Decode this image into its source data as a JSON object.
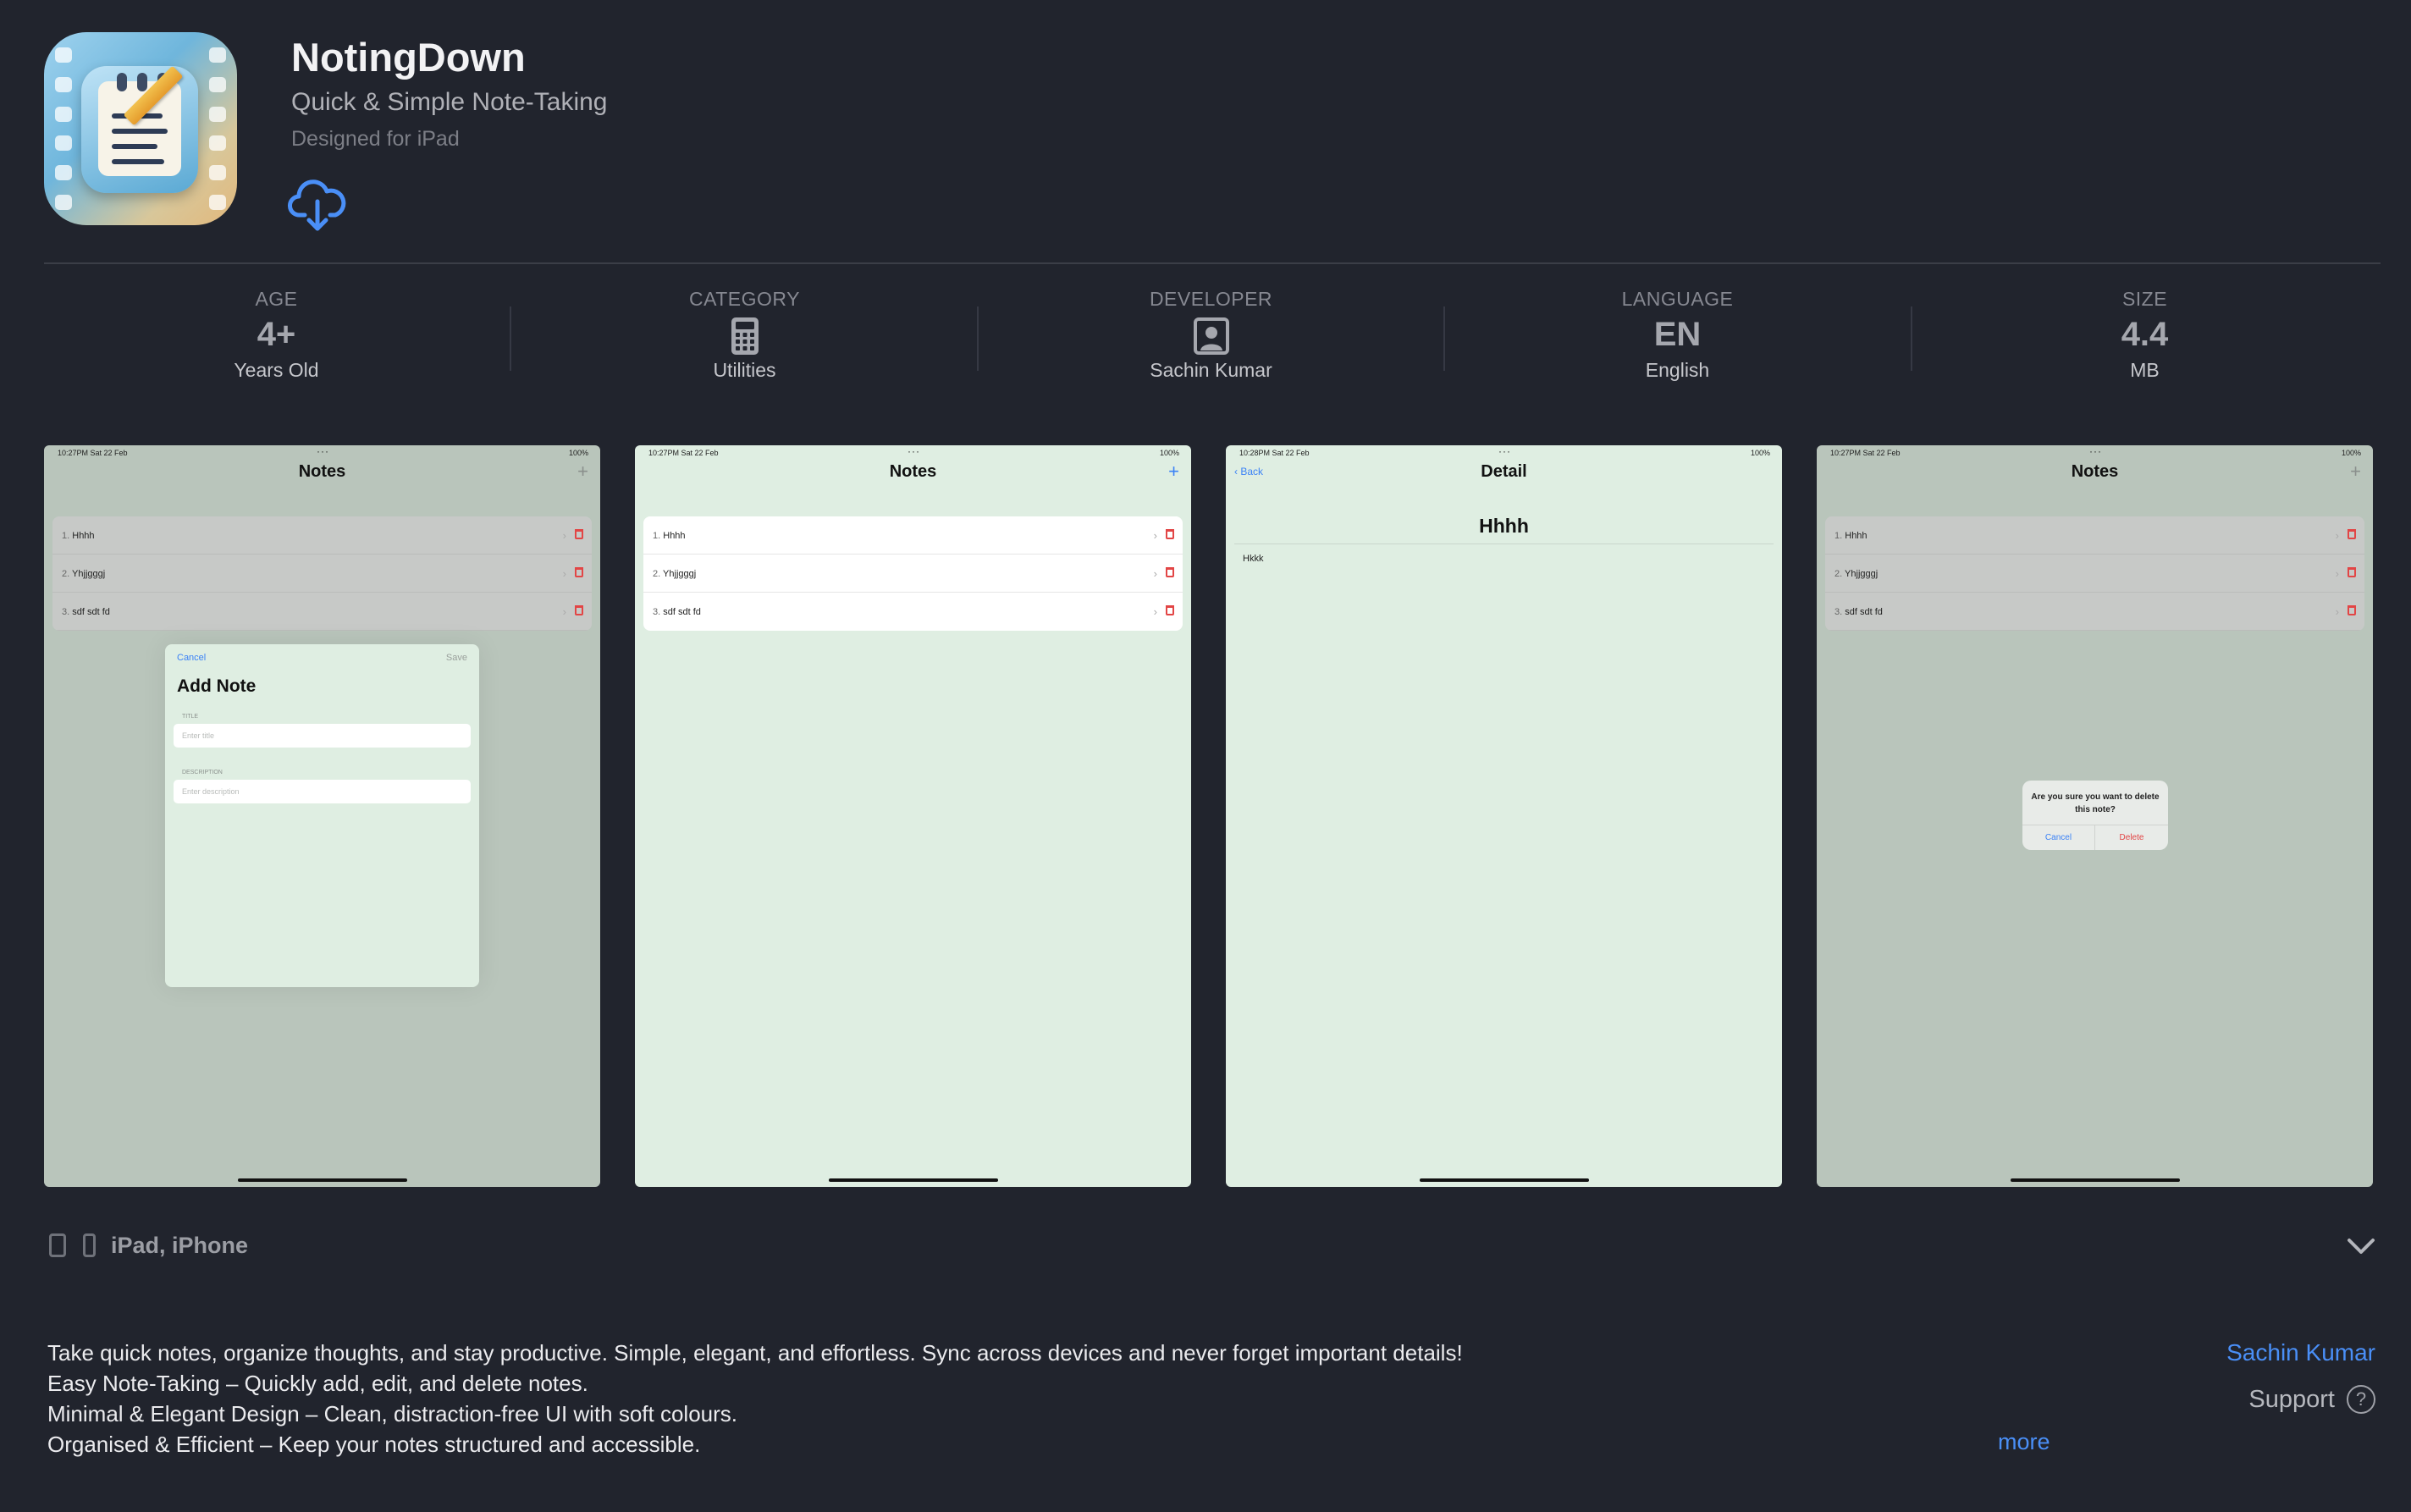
{
  "app": {
    "title": "NotingDown",
    "subtitle": "Quick & Simple Note-Taking",
    "designed_for": "Designed for iPad",
    "get_icon": "cloud-download-icon",
    "accent": "#4a8ff7"
  },
  "info": [
    {
      "label": "AGE",
      "value": "4+",
      "sub": "Years Old"
    },
    {
      "label": "CATEGORY",
      "icon": "calculator-icon",
      "sub": "Utilities"
    },
    {
      "label": "DEVELOPER",
      "icon": "person-icon",
      "sub": "Sachin Kumar"
    },
    {
      "label": "LANGUAGE",
      "value": "EN",
      "sub": "English"
    },
    {
      "label": "SIZE",
      "value": "4.4",
      "sub": "MB"
    }
  ],
  "screenshots": [
    {
      "status_left": "10:27PM  Sat 22 Feb",
      "status_right": "100%",
      "nav_title": "Notes",
      "notes": [
        {
          "num": "1.",
          "title": "Hhhh"
        },
        {
          "num": "2.",
          "title": "Yhjjgggj"
        },
        {
          "num": "3.",
          "title": "sdf sdt fd"
        }
      ],
      "modal": {
        "cancel": "Cancel",
        "save": "Save",
        "title": "Add Note",
        "title_label": "TITLE",
        "title_placeholder": "Enter title",
        "desc_label": "DESCRIPTION",
        "desc_placeholder": "Enter description"
      }
    },
    {
      "status_left": "10:27PM  Sat 22 Feb",
      "status_right": "100%",
      "nav_title": "Notes",
      "notes": [
        {
          "num": "1.",
          "title": "Hhhh"
        },
        {
          "num": "2.",
          "title": "Yhjjgggj"
        },
        {
          "num": "3.",
          "title": "sdf sdt fd"
        }
      ]
    },
    {
      "status_left": "10:28PM  Sat 22 Feb",
      "status_right": "100%",
      "nav_title": "Detail",
      "back": "Back",
      "note_title": "Hhhh",
      "note_body": "Hkkk"
    },
    {
      "status_left": "10:27PM  Sat 22 Feb",
      "status_right": "100%",
      "nav_title": "Notes",
      "notes": [
        {
          "num": "1.",
          "title": "Hhhh"
        },
        {
          "num": "2.",
          "title": "Yhjjgggj"
        },
        {
          "num": "3.",
          "title": "sdf sdt fd"
        }
      ],
      "alert": {
        "message": "Are you sure you want to delete this note?",
        "cancel": "Cancel",
        "delete": "Delete"
      }
    }
  ],
  "platforms": {
    "label": "iPad, iPhone"
  },
  "description": {
    "lines": [
      "Take quick notes, organize thoughts, and stay productive. Simple, elegant, and effortless. Sync across devices and never forget important details!",
      "Easy Note-Taking – Quickly add, edit, and delete notes.",
      "Minimal & Elegant Design – Clean, distraction-free UI with soft colours.",
      "Organised & Efficient – Keep your notes structured and accessible."
    ],
    "more": "more"
  },
  "sidebar": {
    "developer_link": "Sachin Kumar",
    "support": "Support"
  }
}
